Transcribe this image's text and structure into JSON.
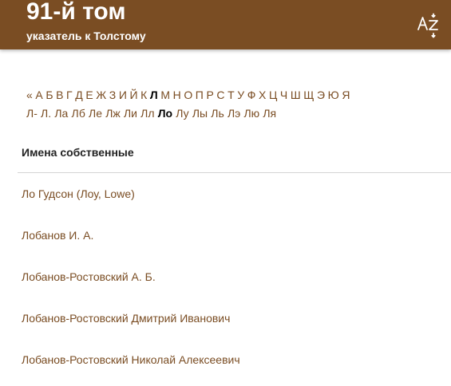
{
  "header": {
    "title": "91-й том",
    "subtitle": "указатель к Толстому",
    "sort_icon": "az-sort-icon",
    "background_color": "#7a4d23"
  },
  "alphabet": {
    "letters": [
      "«",
      "А",
      "Б",
      "В",
      "Г",
      "Д",
      "Е",
      "Ж",
      "З",
      "И",
      "Й",
      "К",
      "Л",
      "М",
      "Н",
      "О",
      "П",
      "Р",
      "С",
      "Т",
      "У",
      "Ф",
      "Х",
      "Ц",
      "Ч",
      "Ш",
      "Щ",
      "Э",
      "Ю",
      "Я"
    ],
    "active_letter": "Л"
  },
  "subindex": {
    "items": [
      "Л-",
      "Л.",
      "Ла",
      "Лб",
      "Ле",
      "Лж",
      "Ли",
      "Лл",
      "Ло",
      "Лу",
      "Лы",
      "Ль",
      "Лэ",
      "Лю",
      "Ля"
    ],
    "active_item": "Ло"
  },
  "section": {
    "title": "Имена собственные"
  },
  "entries": [
    "Ло Гудсон (Лоу, Lowe)",
    "Лобанов И. А.",
    "Лобанов-Ростовский А. Б.",
    "Лобанов-Ростовский Дмитрий Иванович",
    "Лобанов-Ростовский Николай Алексеевич"
  ],
  "colors": {
    "link": "#7a4d23",
    "active": "#000000",
    "divider": "#d4d4d4"
  }
}
